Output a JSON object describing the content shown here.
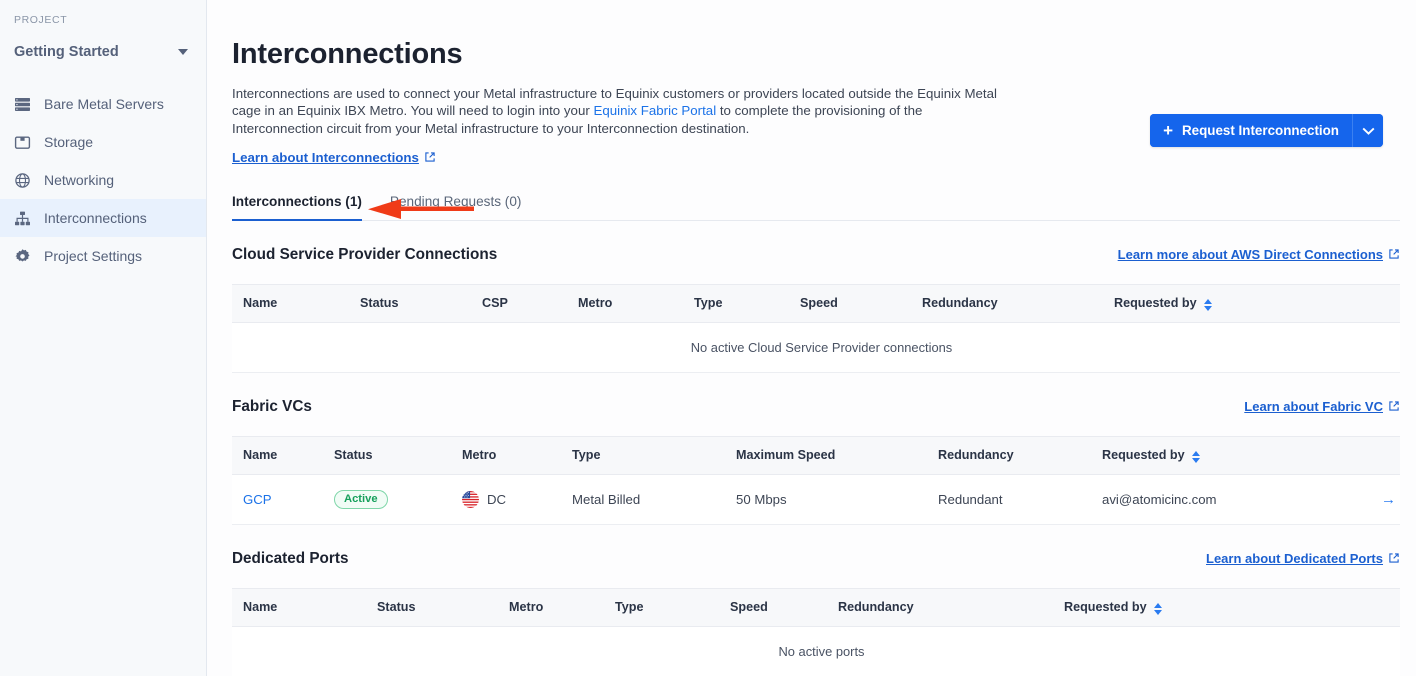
{
  "sidebar": {
    "project_label": "PROJECT",
    "project_name": "Getting Started",
    "items": [
      {
        "label": "Bare Metal Servers",
        "icon": "server-icon"
      },
      {
        "label": "Storage",
        "icon": "storage-icon"
      },
      {
        "label": "Networking",
        "icon": "globe-icon"
      },
      {
        "label": "Interconnections",
        "icon": "interconnections-icon"
      },
      {
        "label": "Project Settings",
        "icon": "gear-icon"
      }
    ],
    "active_index": 3
  },
  "page": {
    "title": "Interconnections",
    "intro_part1": "Interconnections are used to connect your Metal infrastructure to Equinix customers or providers located outside the Equinix Metal cage in an Equinix IBX Metro. You will need to login into your ",
    "intro_link": "Equinix Fabric Portal",
    "intro_part2": " to complete the provisioning of the Interconnection circuit from your Metal infrastructure to your Interconnection destination.",
    "learn_link": "Learn about Interconnections"
  },
  "actions": {
    "request_label": "Request Interconnection",
    "plus_icon": "+",
    "dropdown_icon": "chevron-down-icon",
    "accent_color": "#1565ec"
  },
  "tabs": [
    {
      "label": "Interconnections (1)",
      "active": true
    },
    {
      "label": "Pending Requests (0)",
      "active": false
    }
  ],
  "sections": [
    {
      "title": "Cloud Service Provider Connections",
      "link": "Learn more about AWS Direct Connections",
      "columns": [
        "Name",
        "Status",
        "CSP",
        "Metro",
        "Type",
        "Speed",
        "Redundancy",
        "Requested by",
        ""
      ],
      "col_widths": [
        "128px",
        "122px",
        "96px",
        "116px",
        "106px",
        "122px",
        "192px",
        "200px",
        "auto"
      ],
      "sort_col": 7,
      "rows": [],
      "empty_text": "No active Cloud Service Provider connections"
    },
    {
      "title": "Fabric VCs",
      "link": "Learn about Fabric VC",
      "columns": [
        "Name",
        "Status",
        "Metro",
        "Type",
        "Maximum Speed",
        "Redundancy",
        "Requested by",
        ""
      ],
      "col_widths": [
        "102px",
        "128px",
        "110px",
        "164px",
        "202px",
        "164px",
        "220px",
        "auto"
      ],
      "sort_col": 6,
      "rows": [
        {
          "name": "GCP",
          "status": "Active",
          "metro": "DC",
          "metro_flag": "us-flag-icon",
          "type": "Metal Billed",
          "speed": "50 Mbps",
          "redundancy": "Redundant",
          "requested_by": "avi@atomicinc.com",
          "arrow": "→"
        }
      ],
      "empty_text": ""
    },
    {
      "title": "Dedicated Ports",
      "link": "Learn about Dedicated Ports",
      "columns": [
        "Name",
        "Status",
        "Metro",
        "Type",
        "Speed",
        "Redundancy",
        "Requested by",
        ""
      ],
      "col_widths": [
        "145px",
        "132px",
        "106px",
        "115px",
        "108px",
        "226px",
        "205px",
        "auto"
      ],
      "sort_col": 6,
      "rows": [],
      "empty_text": "No active ports"
    }
  ],
  "annotation": {
    "type": "red-arrow",
    "direction": "left",
    "color": "#f03b18",
    "points_to": "sidebar-item-interconnections"
  }
}
